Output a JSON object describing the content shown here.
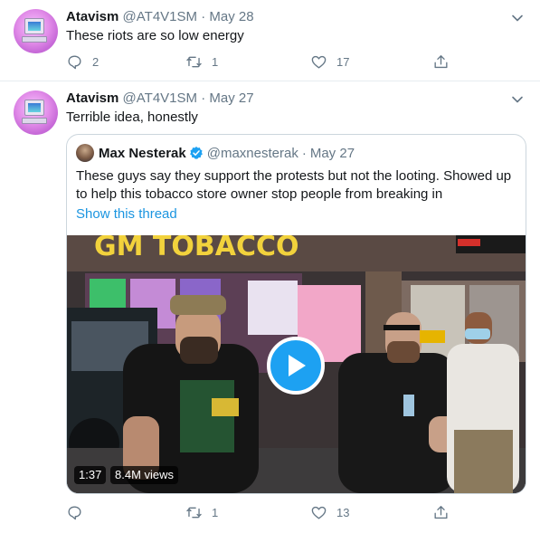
{
  "tweets": [
    {
      "name": "Atavism",
      "handle": "@AT4V1SM",
      "separator": "·",
      "date": "May 28",
      "text": "These riots are so low energy",
      "replies": "2",
      "retweets": "1",
      "likes": "17"
    },
    {
      "name": "Atavism",
      "handle": "@AT4V1SM",
      "separator": "·",
      "date": "May 27",
      "text": "Terrible idea, honestly",
      "replies": "",
      "retweets": "1",
      "likes": "13",
      "quote": {
        "name": "Max Nesterak",
        "handle": "@maxnesterak",
        "separator": "·",
        "date": "May 27",
        "text": "These guys say they support the protests but not the looting. Showed up to help this tobacco store owner stop people from breaking in",
        "link": "Show this thread",
        "video": {
          "duration": "1:37",
          "views": "8.4M views",
          "sign_text": "GM TOBACCO"
        }
      }
    }
  ],
  "colors": {
    "accent": "#1da1f2",
    "link": "#1b95e0",
    "muted": "#657786",
    "border": "#ccd6dd"
  },
  "icons": [
    "chevron-down-icon",
    "reply-icon",
    "retweet-icon",
    "like-icon",
    "share-icon",
    "verified-icon",
    "play-icon"
  ]
}
